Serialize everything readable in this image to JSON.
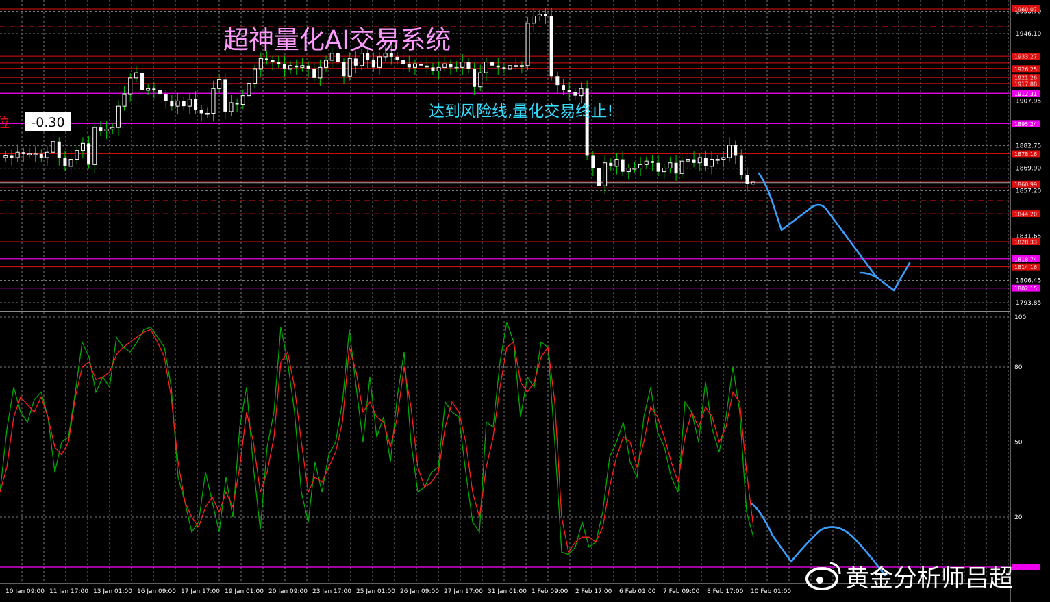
{
  "header": {
    "title": "超神量化AI交易系统",
    "title_color": "#ff99ff",
    "notice": "达到风险线,量化交易终止!",
    "notice_color": "#33ddff",
    "value_box": "-0.30",
    "left_marker": "位",
    "watermark": "黄金分析师吕超"
  },
  "colors": {
    "background": "#000000",
    "grid": "#7a7a7a",
    "candle": "#ffffff",
    "wick": "#00cc00",
    "red_line": "#e01010",
    "magenta_line": "#ff00ff",
    "osc_main": "#00aa00",
    "osc_signal": "#ff2020",
    "forecast": "#3aa0ff"
  },
  "chart_data": [
    {
      "type": "candlestick",
      "title": "超神量化AI交易系统",
      "ylim": [
        1790,
        1962
      ],
      "y_ticks": [
        "1958.70",
        "1946.10",
        "1907.95",
        "1882.75",
        "1869.90",
        "1857.20",
        "1831.65",
        "1806.45",
        "1793.85"
      ],
      "x_ticks": [
        "10 Jan 09:00",
        "11 Jan 17:00",
        "13 Jan 01:00",
        "16 Jan 09:00",
        "17 Jan 17:00",
        "19 Jan 01:00",
        "20 Jan 09:00",
        "23 Jan 17:00",
        "25 Jan 01:00",
        "26 Jan 09:00",
        "27 Jan 17:00",
        "31 Jan 01:00",
        "1 Feb 09:00",
        "2 Feb 17:00",
        "6 Feb 01:00",
        "7 Feb 09:00",
        "8 Feb 17:00",
        "10 Feb 01:00"
      ],
      "closes": [
        1877,
        1876,
        1879,
        1878,
        1878,
        1878,
        1876,
        1879,
        1885,
        1876,
        1871,
        1875,
        1880,
        1884,
        1872,
        1893,
        1891,
        1892,
        1893,
        1905,
        1912,
        1921,
        1924,
        1914,
        1915,
        1914,
        1912,
        1908,
        1905,
        1908,
        1905,
        1909,
        1903,
        1901,
        1901,
        1915,
        1920,
        1902,
        1907,
        1906,
        1911,
        1918,
        1926,
        1932,
        1931,
        1930,
        1929,
        1926,
        1928,
        1927,
        1928,
        1926,
        1921,
        1927,
        1931,
        1935,
        1930,
        1922,
        1932,
        1928,
        1935,
        1931,
        1927,
        1933,
        1935,
        1933,
        1931,
        1929,
        1927,
        1929,
        1928,
        1927,
        1925,
        1927,
        1929,
        1927,
        1927,
        1930,
        1926,
        1916,
        1924,
        1930,
        1928,
        1927,
        1926,
        1928,
        1928,
        1928,
        1952,
        1956,
        1957,
        1956,
        1922,
        1917,
        1914,
        1913,
        1911,
        1915,
        1877,
        1870,
        1860,
        1873,
        1871,
        1875,
        1868,
        1870,
        1870,
        1872,
        1874,
        1873,
        1868,
        1870,
        1873,
        1867,
        1874,
        1875,
        1873,
        1876,
        1871,
        1875,
        1875,
        1876,
        1883,
        1877,
        1866,
        1861,
        1862
      ],
      "red_levels": [
        1960.07,
        1950.0,
        1933.27,
        1929.51,
        1926.25,
        1921.26,
        1917.88,
        1878.16,
        1862.45,
        1858.9,
        1851.6,
        1844.2,
        1828.33,
        1814.16
      ],
      "red_level_labels": [
        "1960.07",
        "1933.27",
        "1926.25",
        "1921.26",
        "1917.88",
        "1878.16",
        "1860.99",
        "1844.20",
        "1828.33",
        "1814.16"
      ],
      "magenta_levels": [
        1912.31,
        1895.24,
        1818.74,
        1802.15
      ],
      "magenta_level_labels": [
        "1912.31",
        "1895.24",
        "1818.74",
        "1802.15"
      ],
      "last_price": 1860.99
    },
    {
      "type": "line",
      "title": "",
      "ylim": [
        0,
        100
      ],
      "y_ticks": [
        "100",
        "80",
        "50",
        "20"
      ],
      "series": [
        {
          "values": [
            30,
            55,
            72,
            62,
            58,
            67,
            70,
            60,
            38,
            50,
            52,
            70,
            90,
            84,
            70,
            76,
            72,
            92,
            88,
            86,
            90,
            95,
            96,
            92,
            88,
            72,
            36,
            26,
            14,
            18,
            38,
            26,
            14,
            36,
            20,
            56,
            72,
            40,
            15,
            48,
            62,
            96,
            82,
            62,
            30,
            18,
            42,
            30,
            45,
            50,
            66,
            95,
            72,
            50,
            76,
            52,
            60,
            42,
            68,
            86,
            50,
            30,
            32,
            38,
            40,
            66,
            62,
            60,
            38,
            18,
            14,
            58,
            56,
            82,
            98,
            90,
            60,
            76,
            72,
            90,
            88,
            50,
            6,
            5,
            8,
            18,
            8,
            10,
            22,
            44,
            50,
            58,
            42,
            36,
            60,
            72,
            54,
            48,
            36,
            30,
            66,
            62,
            50,
            74,
            55,
            46,
            60,
            80,
            62,
            22,
            12
          ]
        },
        {
          "values": [
            30,
            40,
            60,
            68,
            65,
            62,
            68,
            60,
            48,
            45,
            50,
            68,
            80,
            82,
            75,
            76,
            78,
            85,
            88,
            90,
            92,
            94,
            95,
            90,
            84,
            68,
            42,
            26,
            20,
            16,
            24,
            28,
            22,
            30,
            24,
            40,
            62,
            50,
            30,
            38,
            52,
            82,
            86,
            72,
            50,
            30,
            36,
            34,
            40,
            46,
            58,
            88,
            78,
            62,
            66,
            60,
            58,
            48,
            60,
            80,
            64,
            40,
            32,
            34,
            38,
            56,
            66,
            62,
            50,
            30,
            20,
            40,
            52,
            72,
            88,
            90,
            74,
            70,
            74,
            84,
            88,
            66,
            20,
            6,
            10,
            12,
            12,
            10,
            16,
            32,
            44,
            52,
            50,
            40,
            50,
            64,
            60,
            52,
            42,
            34,
            52,
            62,
            56,
            64,
            60,
            50,
            56,
            70,
            66,
            38,
            16
          ]
        }
      ]
    }
  ]
}
